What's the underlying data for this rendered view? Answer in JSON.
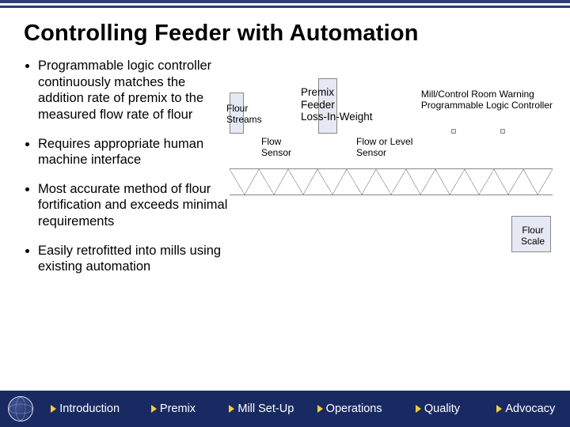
{
  "title": "Controlling Feeder with Automation",
  "bullets": [
    "Programmable logic controller continuously matches the addition rate of premix to the measured flow rate of flour",
    "Requires appropriate human machine interface",
    "Most accurate method of flour fortification and exceeds minimal requirements",
    "Easily retrofitted into mills using existing automation"
  ],
  "diagram": {
    "flour_streams": "Flour\nStreams",
    "premix_feeder": "Premix\nFeeder\nLoss-In-Weight",
    "flow_sensor": "Flow\nSensor",
    "flow_level_sensor": "Flow or Level\nSensor",
    "controller": "Mill/Control Room Warning\nProgrammable Logic Controller",
    "flour_scale": "Flour\nScale"
  },
  "nav": {
    "introduction": "Introduction",
    "premix": "Premix",
    "mill_setup": "Mill Set-Up",
    "operations": "Operations",
    "quality": "Quality",
    "advocacy": "Advocacy"
  }
}
